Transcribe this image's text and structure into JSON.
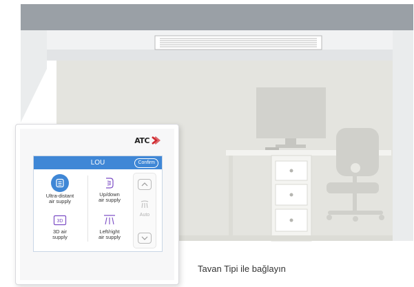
{
  "panel": {
    "brand": "ATC",
    "header_title": "LOU",
    "confirm_label": "Confirm",
    "modes": [
      {
        "icon": "ultra-distant-air-icon",
        "label_line1": "Ultra-distant",
        "label_line2": "air supply",
        "active": true
      },
      {
        "icon": "up-down-air-icon",
        "label_line1": "Up/down",
        "label_line2": "air supply",
        "active": false
      },
      {
        "icon": "3d-air-icon",
        "label_line1": "3D air",
        "label_line2": "supply",
        "active": false
      },
      {
        "icon": "left-right-air-icon",
        "label_line1": "Left/right",
        "label_line2": "air supply",
        "active": false
      }
    ],
    "side": {
      "up_icon": "chevron-up-icon",
      "auto_label": "Auto",
      "down_icon": "chevron-down-icon"
    },
    "accent_color": "#3f87d6"
  },
  "caption": "Tavan Tipi ile bağlayın"
}
